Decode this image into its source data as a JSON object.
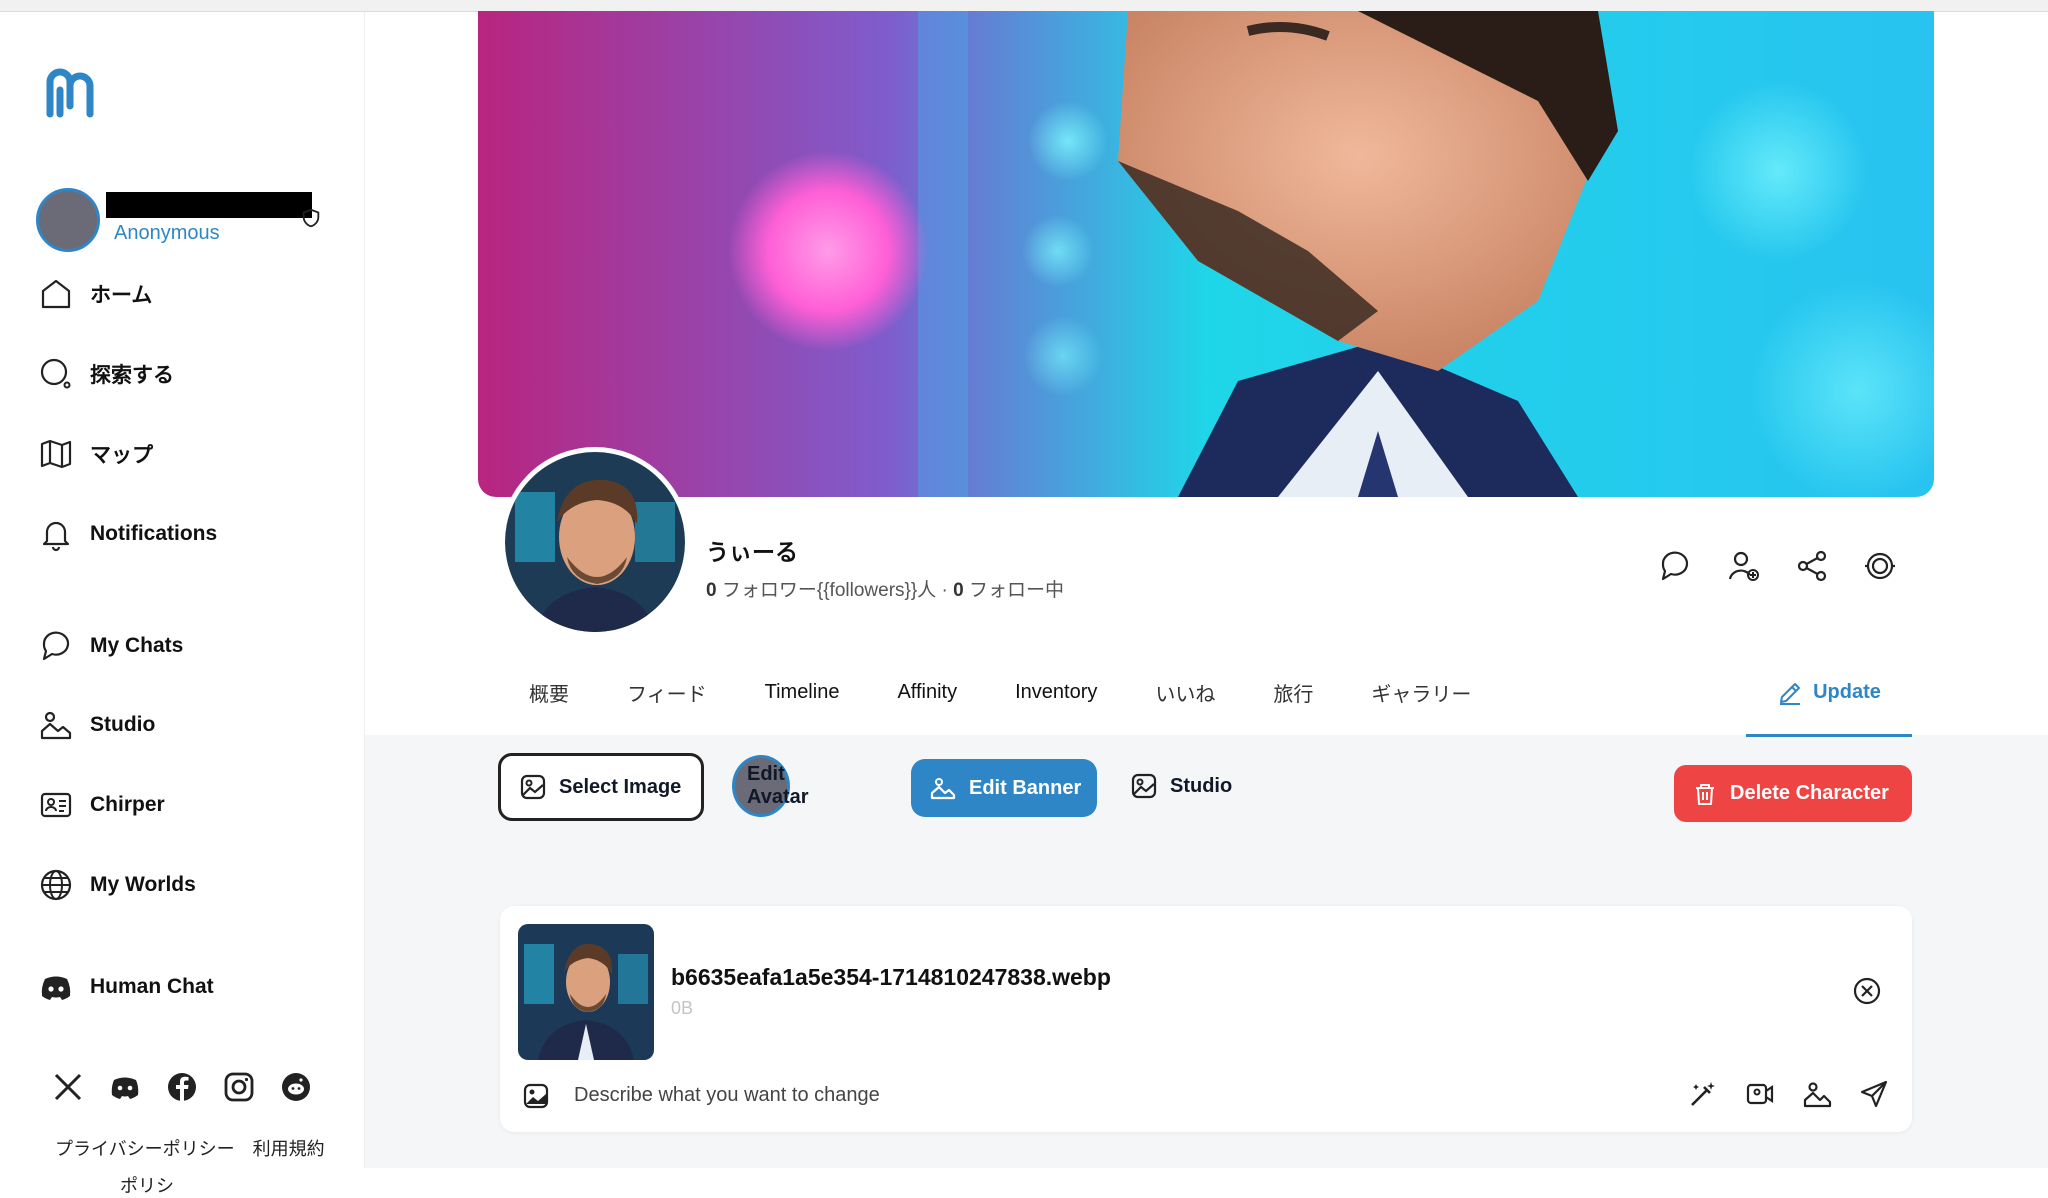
{
  "sidebar": {
    "user": {
      "role": "Anonymous"
    },
    "nav": [
      {
        "label": "ホーム",
        "icon": "home-icon"
      },
      {
        "label": "探索する",
        "icon": "search-icon"
      },
      {
        "label": "マップ",
        "icon": "map-icon"
      },
      {
        "label": "Notifications",
        "icon": "bell-icon"
      },
      {
        "label": "My Chats",
        "icon": "chat-icon"
      },
      {
        "label": "Studio",
        "icon": "studio-icon"
      },
      {
        "label": "Chirper",
        "icon": "id-card-icon"
      },
      {
        "label": "My Worlds",
        "icon": "globe-icon"
      },
      {
        "label": "Human Chat",
        "icon": "discord-icon"
      }
    ],
    "social": [
      "x-icon",
      "discord-icon",
      "facebook-icon",
      "instagram-icon",
      "reddit-icon"
    ],
    "legal": {
      "privacy": "プライバシーポリシー",
      "terms": "利用規約",
      "cutoff": "ポリシ"
    }
  },
  "profile": {
    "name": "うぃーる",
    "followers_count": "0",
    "followers_label": "フォロワー{{followers}}人",
    "separator": "·",
    "following_count": "0",
    "following_label": "フォロー中"
  },
  "tabs": [
    "概要",
    "フィード",
    "Timeline",
    "Affinity",
    "Inventory",
    "いいね",
    "旅行",
    "ギャラリー"
  ],
  "update_tab": "Update",
  "actions": {
    "select_image": "Select Image",
    "edit_avatar": "Edit Avatar",
    "edit_banner": "Edit Banner",
    "studio": "Studio",
    "delete": "Delete Character"
  },
  "upload": {
    "filename": "b6635eafa1a5e354-1714810247838.webp",
    "size": "0B",
    "placeholder": "Describe what you want to change"
  },
  "colors": {
    "accent": "#2f86c6",
    "danger": "#ef4444",
    "gray_bg": "#f4f6f8"
  }
}
